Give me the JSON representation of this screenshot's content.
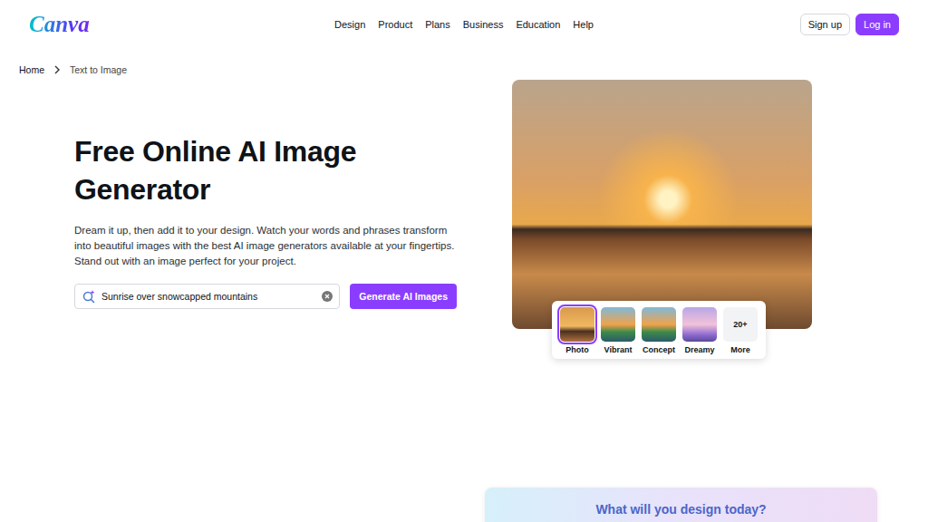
{
  "header": {
    "logo": "Canva",
    "nav": [
      "Design",
      "Product",
      "Plans",
      "Business",
      "Education",
      "Help"
    ],
    "buttons": [
      {
        "label": "Sign up",
        "kind": "outline"
      },
      {
        "label": "Log in",
        "kind": "primary"
      }
    ]
  },
  "breadcrumb": [
    {
      "label": "Home"
    },
    {
      "label": "Text to Image"
    }
  ],
  "hero": {
    "title": "Free Online AI Image Generator",
    "description": "Dream it up, then add it to your design. Watch your words and phrases transform into beautiful images with the best AI image generators available at your fingertips. Stand out with an image perfect for your project.",
    "search": {
      "value": "Sunrise over snowcapped mountains"
    },
    "button": "Generate AI Images"
  },
  "styles": [
    {
      "label": "Photo",
      "kind": "thumb",
      "selected": true
    },
    {
      "label": "Vibrant",
      "kind": "thumb",
      "selected": false
    },
    {
      "label": "Concept",
      "kind": "thumb",
      "selected": false
    },
    {
      "label": "Dreamy",
      "kind": "thumb",
      "selected": false
    },
    {
      "label": "More",
      "kind": "more",
      "badge": "20+",
      "selected": false
    }
  ],
  "promo": {
    "title": "What will you design today?"
  }
}
